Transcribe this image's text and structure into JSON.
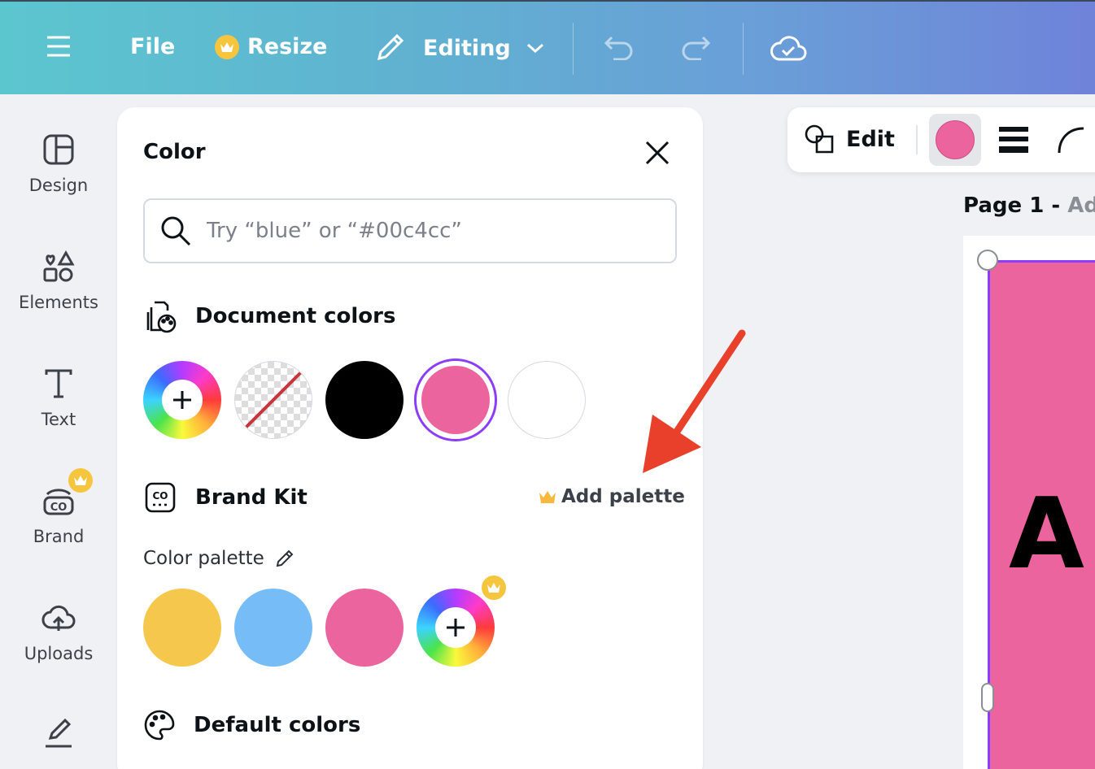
{
  "topbar": {
    "file_label": "File",
    "resize_label": "Resize",
    "editing_label": "Editing"
  },
  "sidebar": {
    "items": [
      {
        "label": "Design"
      },
      {
        "label": "Elements"
      },
      {
        "label": "Text"
      },
      {
        "label": "Brand"
      },
      {
        "label": "Uploads"
      }
    ]
  },
  "color_panel": {
    "title": "Color",
    "search_placeholder": "Try “blue” or “#00c4cc”",
    "document_colors": {
      "heading": "Document colors",
      "swatches": [
        "#000000",
        "#ec649e",
        "#ffffff"
      ],
      "selected": "#ec649e"
    },
    "brand_kit": {
      "heading": "Brand Kit",
      "add_palette_label": "Add palette",
      "palette_label": "Color palette",
      "swatches": [
        "#f5c74c",
        "#76bdf7",
        "#ec649e"
      ]
    },
    "default_colors": {
      "heading": "Default colors"
    }
  },
  "floating_toolbar": {
    "edit_label": "Edit",
    "current_color": "#ec649e"
  },
  "canvas": {
    "page_label": "Page 1 -",
    "page_title_placeholder": "Add",
    "big_text": "A"
  },
  "colors": {
    "accent_purple": "#8b3dff",
    "pink": "#ec649e",
    "crown_gold": "#f6c53e",
    "arrow_red": "#e8402a"
  }
}
